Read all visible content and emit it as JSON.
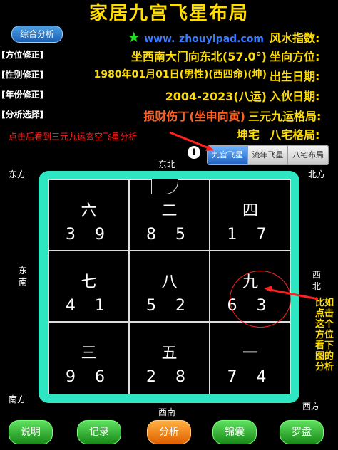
{
  "title": "家居九宫飞星布局",
  "summary_button": "综合分析",
  "rows": [
    {
      "label": "风水指数:",
      "value_prefix": "www.",
      "value_url": "zhouyipad.com",
      "side": ""
    },
    {
      "label": "坐向方位:",
      "value": "坐西南大门向东北(57.0°)",
      "side": "[方位修正]"
    },
    {
      "label": "出生日期:",
      "value": "1980年01月01日(男性)(西四命)(坤)",
      "side": "[性别修正]"
    },
    {
      "label": "入伙日期:",
      "value": "2004-2023(八运)",
      "side": "[年份修正]"
    },
    {
      "label": "三元九运格局:",
      "value": "损财伤丁(坐申向寅)",
      "side": "[分析选择]"
    },
    {
      "label": "八宅格局:",
      "value": "坤宅",
      "side": ""
    }
  ],
  "hint_left": "点击后看到三元九运玄空飞星分析",
  "tabs": [
    "九宫飞星",
    "流年飞星",
    "八宅布局"
  ],
  "active_tab": 0,
  "info_icon": "i",
  "directions": {
    "top_left": "东方",
    "top_center": "东北",
    "top_right": "北方",
    "left_middle": "东\n南",
    "right_middle": "西\n北",
    "bottom_left": "南方",
    "bottom_center": "西南",
    "bottom_right": "西方"
  },
  "grid": [
    {
      "star": "六",
      "digits": "3 9"
    },
    {
      "star": "二",
      "digits": "8 5"
    },
    {
      "star": "四",
      "digits": "1 7"
    },
    {
      "star": "七",
      "digits": "4 1"
    },
    {
      "star": "八",
      "digits": "5 2"
    },
    {
      "star": "九",
      "digits": "6 3"
    },
    {
      "star": "三",
      "digits": "9 6"
    },
    {
      "star": "五",
      "digits": "2 8"
    },
    {
      "star": "一",
      "digits": "7 4"
    }
  ],
  "vertical_note": "比如点击这个方位看下图的分析",
  "buttons": [
    "说明",
    "记录",
    "分析",
    "锦囊",
    "罗盘"
  ],
  "colors": {
    "accent": "#ffdd00",
    "board": "#2ee6c2",
    "annotation": "#ff2020"
  }
}
